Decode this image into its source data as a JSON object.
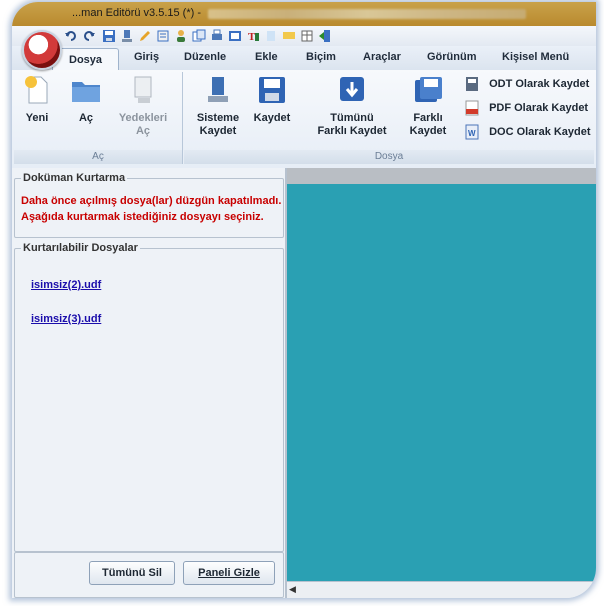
{
  "app": {
    "title": "...man Editörü v3.5.15 (*) -"
  },
  "tabs": [
    {
      "label": "Dosya",
      "active": true
    },
    {
      "label": "Giriş"
    },
    {
      "label": "Düzenle"
    },
    {
      "label": "Ekle"
    },
    {
      "label": "Biçim"
    },
    {
      "label": "Araçlar"
    },
    {
      "label": "Görünüm"
    },
    {
      "label": "Kişisel Menü"
    }
  ],
  "ribbon": {
    "group_ac": {
      "label": "Aç",
      "yeni": "Yeni",
      "ac": "Aç",
      "yedekleri_ac_line1": "Yedekleri",
      "yedekleri_ac_line2": "Aç"
    },
    "group_dosya": {
      "label": "Dosya",
      "sisteme_kaydet_line1": "Sisteme",
      "sisteme_kaydet_line2": "Kaydet",
      "kaydet": "Kaydet",
      "tumunu_line1": "Tümünü",
      "tumunu_line2": "Farklı Kaydet",
      "farkli_line1": "Farklı",
      "farkli_line2": "Kaydet",
      "odt": "ODT Olarak Kaydet",
      "pdf": "PDF Olarak Kaydet",
      "doc": "DOC Olarak Kaydet"
    }
  },
  "recovery": {
    "title": "Doküman Kurtarma",
    "warning_line1": "Daha önce açılmış dosya(lar) düzgün kapatılmadı.",
    "warning_line2": "Aşağıda kurtarmak istediğiniz dosyayı seçiniz.",
    "files_title": "Kurtarılabilir Dosyalar",
    "files": [
      "isimsiz(2).udf",
      "isimsiz(3).udf"
    ],
    "delete_all": "Tümünü Sil",
    "hide_panel": "Paneli Gizle"
  },
  "colors": {
    "workspace": "#2aa0b3",
    "warning": "#c80000",
    "titlebar": "#b98a2e"
  }
}
